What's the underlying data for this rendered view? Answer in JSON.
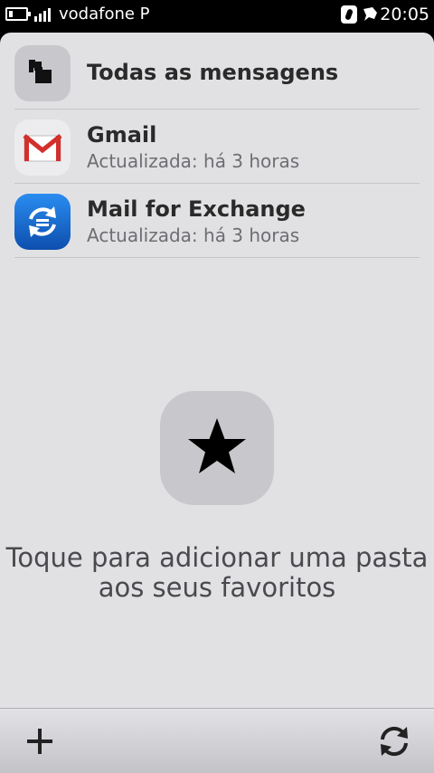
{
  "status_bar": {
    "operator": "vodafone P",
    "time": "20:05",
    "icons": [
      "battery-icon",
      "signal-icon",
      "nfc-icon",
      "notification-icon"
    ]
  },
  "accounts": [
    {
      "title": "Todas as mensagens",
      "subtitle": "",
      "icon": "folders-icon"
    },
    {
      "title": "Gmail",
      "subtitle": "Actualizada: há 3 horas",
      "icon": "gmail-icon"
    },
    {
      "title": "Mail for Exchange",
      "subtitle": "Actualizada: há 3 horas",
      "icon": "exchange-icon"
    }
  ],
  "favorites": {
    "icon": "star-icon",
    "hint_line1": "Toque para adicionar uma pasta",
    "hint_line2": "aos seus favoritos"
  },
  "toolbar": {
    "left_icon": "add-icon",
    "right_icon": "refresh-icon"
  },
  "colors": {
    "panel_bg": "#e1e1e4",
    "gmail_red": "#d2302c",
    "exchange_blue": "#1a6fd0"
  }
}
